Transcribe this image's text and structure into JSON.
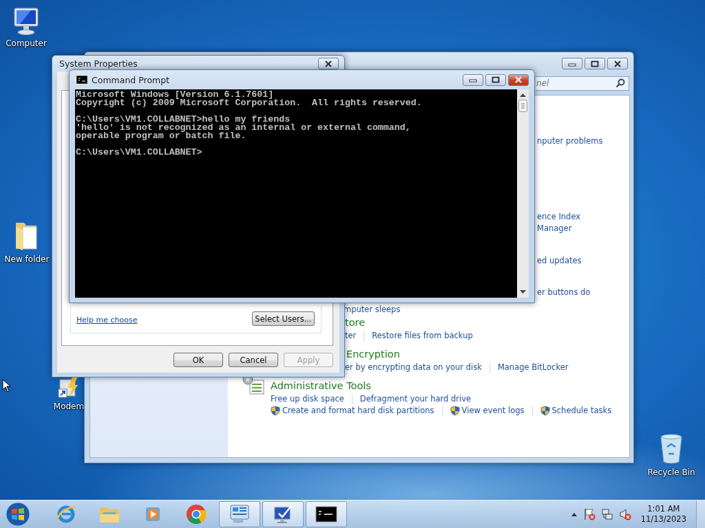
{
  "desktop_icons": [
    {
      "kind": "computer",
      "label": "Computer"
    },
    {
      "kind": "folder",
      "label": "New folder"
    },
    {
      "kind": "shortcut",
      "label": "Modem"
    },
    {
      "kind": "recycle-bin",
      "label": "Recycle Bin"
    }
  ],
  "control_panel": {
    "search": {
      "placeholder": "nel"
    },
    "rows": [
      {
        "kind": "links",
        "links": [
          {
            "text": "nputer problems",
            "shield": false
          }
        ]
      },
      {
        "kind": "links",
        "links": [
          {
            "text": "ence Index",
            "shield": false
          }
        ]
      },
      {
        "kind": "links",
        "links": [
          {
            "text": "Manager",
            "shield": false
          }
        ]
      },
      {
        "kind": "links",
        "links": [
          {
            "text": "ed updates",
            "shield": false
          }
        ]
      },
      {
        "kind": "links",
        "links": [
          {
            "text": "er buttons do",
            "shield": false
          }
        ]
      },
      {
        "kind": "links",
        "links": [
          {
            "text": "mputer sleeps",
            "shield": false
          }
        ]
      },
      {
        "kind": "heading",
        "text": "tore"
      },
      {
        "kind": "links",
        "links": [
          {
            "text": "ter",
            "shield": false
          },
          {
            "text": "Restore files from backup",
            "shield": false
          }
        ]
      },
      {
        "kind": "heading",
        "text": "Encryption"
      },
      {
        "kind": "links",
        "links": [
          {
            "text": "er by encrypting data on your disk",
            "shield": false
          },
          {
            "text": "Manage BitLocker",
            "shield": false
          }
        ]
      },
      {
        "kind": "category",
        "text": "Administrative Tools"
      },
      {
        "kind": "links",
        "links": [
          {
            "text": "Free up disk space",
            "shield": false
          },
          {
            "text": "Defragment your hard drive",
            "shield": false
          }
        ]
      },
      {
        "kind": "links",
        "links": [
          {
            "text": "Create and format hard disk partitions",
            "shield": true
          },
          {
            "text": "View event logs",
            "shield": true
          },
          {
            "text": "Schedule tasks",
            "shield": true
          }
        ]
      }
    ]
  },
  "system_properties": {
    "title": "System Properties",
    "link": "Help me choose",
    "select_button": "Select Users...",
    "buttons": [
      {
        "label": "OK",
        "disabled": false
      },
      {
        "label": "Cancel",
        "disabled": false
      },
      {
        "label": "Apply",
        "disabled": true
      }
    ]
  },
  "command_prompt": {
    "title": "Command Prompt",
    "blocks": [
      [
        "Microsoft Windows [Version 6.1.7601]",
        "Copyright (c) 2009 Microsoft Corporation.  All rights reserved."
      ],
      [
        "C:\\Users\\VM1.COLLABNET>hello my friends",
        "'hello' is not recognized as an internal or external command,",
        "operable program or batch file."
      ],
      [
        "C:\\Users\\VM1.COLLABNET>"
      ]
    ]
  },
  "taskbar": {
    "items": [
      {
        "kind": "ie",
        "open": false
      },
      {
        "kind": "explorer",
        "open": false
      },
      {
        "kind": "media",
        "open": false
      },
      {
        "kind": "chrome",
        "open": false
      },
      {
        "kind": "control-panel",
        "open": true
      },
      {
        "kind": "system",
        "open": true
      },
      {
        "kind": "cmd",
        "open": true
      }
    ],
    "time": "1:01 AM",
    "date": "11/13/2023"
  }
}
